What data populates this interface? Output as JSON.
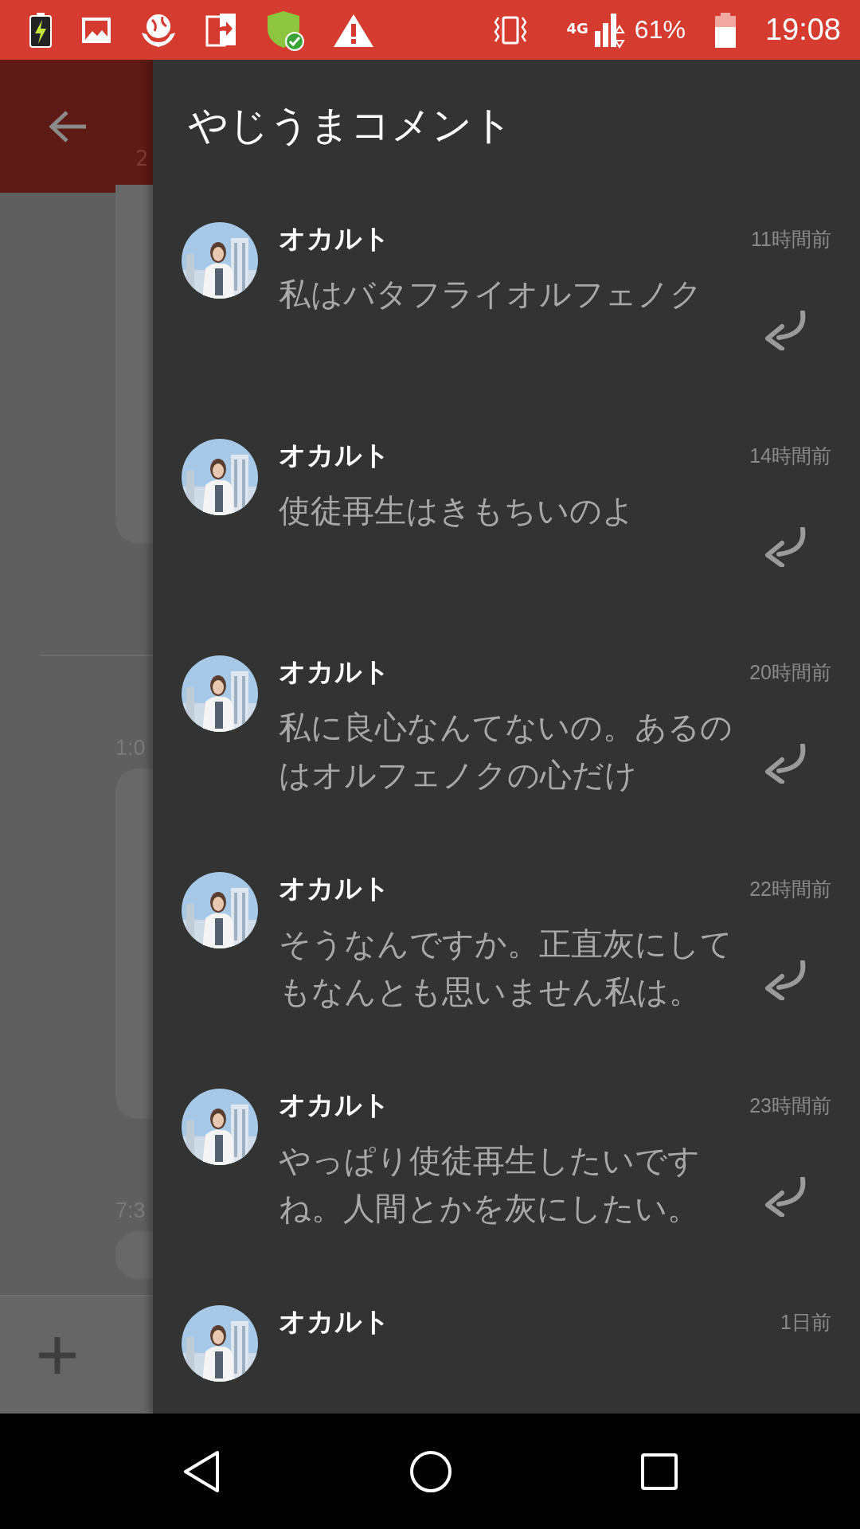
{
  "status_bar": {
    "network": "4G",
    "battery": "61%",
    "time": "19:08"
  },
  "background_screen": {
    "subtitle": "2",
    "timestamps": [
      "1:0",
      "7:3"
    ]
  },
  "drawer": {
    "title": "やじうまコメント",
    "comments": [
      {
        "author": "オカルト",
        "time": "11時間前",
        "message": "私はバタフライオルフェノク"
      },
      {
        "author": "オカルト",
        "time": "14時間前",
        "message": "使徒再生はきもちいのよ"
      },
      {
        "author": "オカルト",
        "time": "20時間前",
        "message": "私に良心なんてないの。あるのはオルフェノクの心だけ"
      },
      {
        "author": "オカルト",
        "time": "22時間前",
        "message": "そうなんですか。正直灰にしてもなんとも思いません私は。"
      },
      {
        "author": "オカルト",
        "time": "23時間前",
        "message": "やっぱり使徒再生したいですね。人間とかを灰にしたい。"
      },
      {
        "author": "オカルト",
        "time": "1日前"
      }
    ]
  }
}
